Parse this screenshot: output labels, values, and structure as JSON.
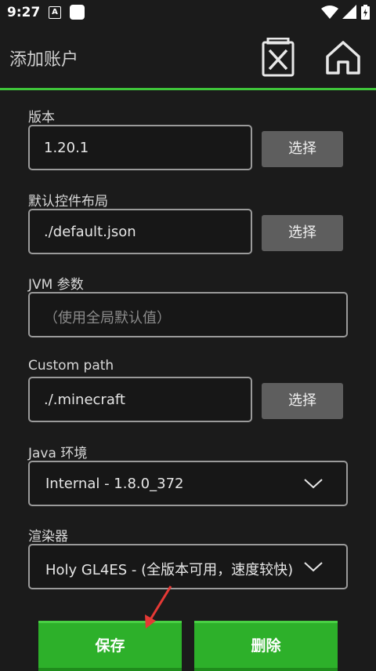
{
  "status": {
    "time": "9:27",
    "notif_letter": "A"
  },
  "appbar": {
    "title": "添加账户"
  },
  "fields": {
    "version": {
      "label": "版本",
      "value": "1.20.1",
      "button": "选择"
    },
    "layout": {
      "label": "默认控件布局",
      "value": "./default.json",
      "button": "选择"
    },
    "jvm": {
      "label": "JVM 参数",
      "placeholder": "（使用全局默认值）"
    },
    "custom_path": {
      "label": "Custom path",
      "value": "./.minecraft",
      "button": "选择"
    },
    "java": {
      "label": "Java 环境",
      "value": "Internal - 1.8.0_372"
    },
    "renderer": {
      "label": "渲染器",
      "value": "Holy GL4ES - (全版本可用，速度较快)"
    }
  },
  "actions": {
    "save": "保存",
    "delete": "删除"
  },
  "colors": {
    "accent": "#3fc53a",
    "button_green": "#2db02a",
    "arrow": "#e53935"
  }
}
